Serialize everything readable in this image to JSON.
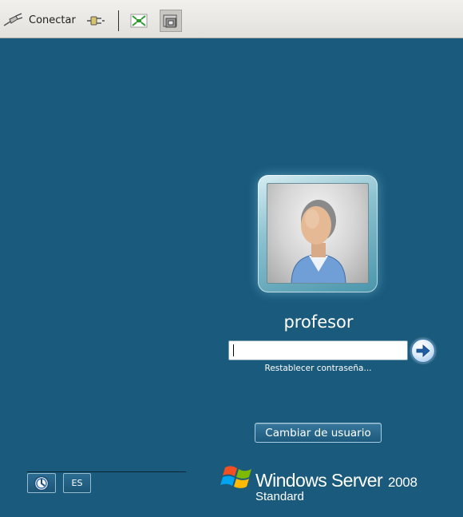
{
  "toolbar": {
    "connect_label": "Conectar",
    "icons": {
      "connect": "plug-connect-icon",
      "disconnect": "plug-disconnect-icon",
      "fit": "fit-to-window-icon",
      "fullscreen": "fullscreen-icon"
    }
  },
  "login": {
    "username": "profesor",
    "password_value": "",
    "reset_link": "Restablecer contraseña...",
    "switch_user": "Cambiar de usuario",
    "submit_icon": "arrow-right-icon"
  },
  "bottom": {
    "language": "ES",
    "accessibility_icon": "ease-of-access-icon"
  },
  "brand": {
    "name": "Windows Server",
    "version": "2008",
    "edition": "Standard"
  },
  "colors": {
    "background": "#1a5a7c",
    "toolbar": "#e9e8e4",
    "button": "#2a6a8e"
  }
}
